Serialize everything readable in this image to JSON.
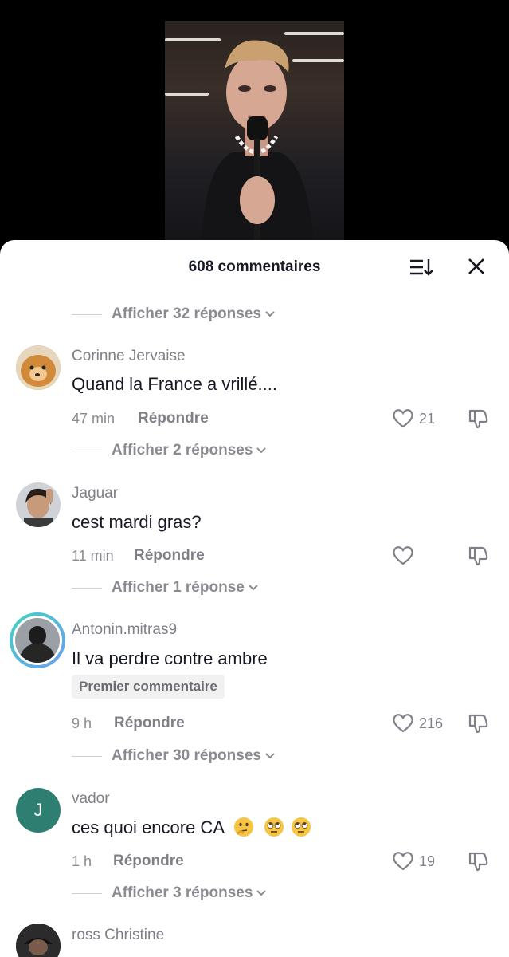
{
  "header": {
    "title": "608 commentaires"
  },
  "top_replies": {
    "label": "Afficher 32 réponses"
  },
  "comments": [
    {
      "username": "Corinne Jervaise",
      "text": "Quand la France a vrillé....",
      "time": "47 min",
      "reply_label": "Répondre",
      "likes": "21",
      "replies_label": "Afficher 2 réponses"
    },
    {
      "username": "Jaguar",
      "text": "cest mardi gras?",
      "time": "11 min",
      "reply_label": "Répondre",
      "likes": "",
      "replies_label": "Afficher 1 réponse"
    },
    {
      "username": "Antonin.mitras9",
      "text": "Il va perdre contre ambre",
      "badge": "Premier commentaire",
      "time": "9 h",
      "reply_label": "Répondre",
      "likes": "216",
      "replies_label": "Afficher 30 réponses"
    },
    {
      "username": "vador",
      "avatar_letter": "J",
      "text": "ces quoi encore CA",
      "time": "1 h",
      "reply_label": "Répondre",
      "likes": "19",
      "replies_label": "Afficher 3 réponses"
    },
    {
      "username": "ross Christine"
    }
  ],
  "icons": [
    "sort-icon",
    "close-icon",
    "heart-icon",
    "dislike-icon",
    "chevron-down-icon",
    "thinking-emoji",
    "eye-roll-emoji"
  ],
  "colors": {
    "sheet": "#ffffff",
    "text": "#161823",
    "muted": "#8a8b91",
    "avatar_green": "#2e7f72"
  }
}
